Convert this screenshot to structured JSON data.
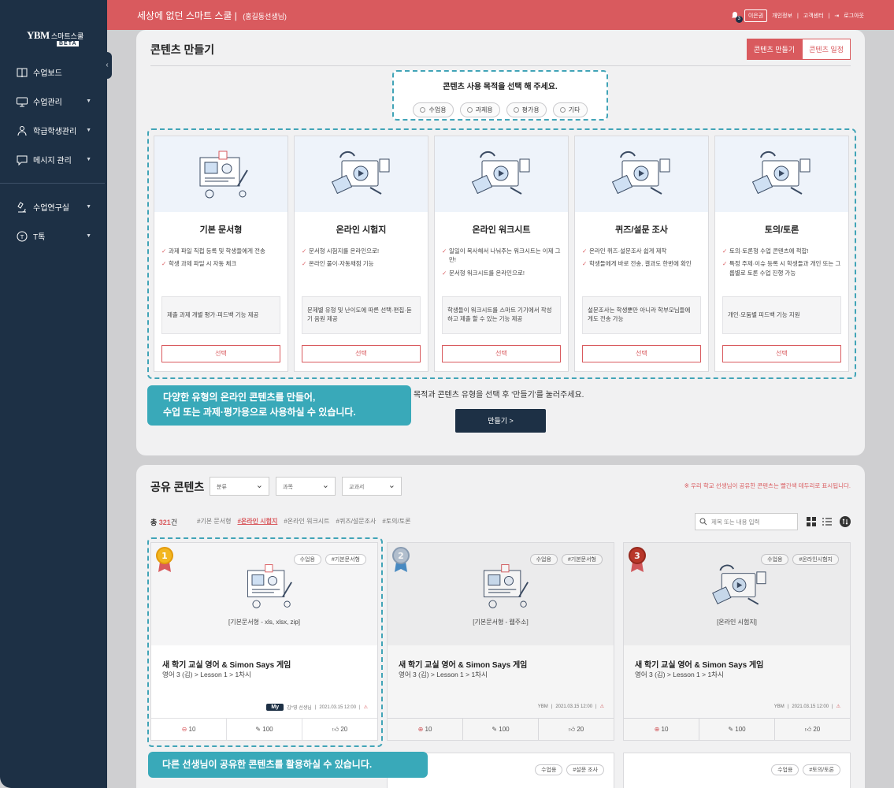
{
  "brand": {
    "logo_text": "YBM",
    "service": "스마트스쿨",
    "beta": "BETA"
  },
  "header": {
    "school_name": "세상에 없던 스마트 스쿨",
    "teacher": "(홍길동선생님)",
    "notif_count": "3",
    "user": "이은권",
    "links": [
      "개인정보",
      "고객센터",
      "로그아웃"
    ]
  },
  "sidebar": {
    "items": [
      {
        "label": "수업보드",
        "icon": "book-icon",
        "caret": false
      },
      {
        "label": "수업관리",
        "icon": "monitor-icon",
        "caret": true
      },
      {
        "label": "학급학생관리",
        "icon": "students-icon",
        "caret": true
      },
      {
        "label": "메시지 관리",
        "icon": "message-icon",
        "caret": true
      },
      {
        "label": "수업연구실",
        "icon": "microscope-icon",
        "caret": true
      },
      {
        "label": "T톡",
        "icon": "t-talk-icon",
        "caret": true
      }
    ]
  },
  "create": {
    "title": "콘텐츠 만들기",
    "tabs": [
      "콘텐츠 만들기",
      "콘텐츠 일정"
    ],
    "purpose_question": "콘텐츠 사용 목적을 선택 해 주세요.",
    "purpose_options": [
      "수업용",
      "과제용",
      "평가용",
      "기타"
    ],
    "cards": [
      {
        "name": "기본 문서형",
        "features": [
          "과제 파일 직접 등록 및 학생들에게 전송",
          "학생 과제 파일 시 자동 체크"
        ],
        "note": "제출 과제 개별 평가·피드백 기능 제공",
        "button": "선택"
      },
      {
        "name": "온라인 시험지",
        "features": [
          "문서형 시험지를 온라인으로!",
          "온라인 풀이·자동채점 기능"
        ],
        "note": "문제별 유형 및 난이도에 따른 선택·편집·듣기 음원 제공",
        "button": "선택"
      },
      {
        "name": "온라인 워크시트",
        "features": [
          "일일이 복사해서 나눠주는 워크시트는 이제 그만!",
          "문서형 워크시트를 온라인으로!"
        ],
        "note": "학생들이 워크시트를 스마트 기기에서 작성하고 제출 할 수 있는 기능 제공",
        "button": "선택"
      },
      {
        "name": "퀴즈/설문 조사",
        "features": [
          "온라인 퀴즈·설문조사 쉽게 제작",
          "학생들에게 바로 전송, 결과도 한번에 확인"
        ],
        "note": "설문조사는 학생뿐만 아니라 학부모님들에게도 전송 가능",
        "button": "선택"
      },
      {
        "name": "토의/토론",
        "features": [
          "토의·토론형 수업 콘텐츠에 적합!",
          "특정 주제·이슈 등록 시 학생들과 개인 또는 그룹별로 토론 수업 진행 가능"
        ],
        "note": "개인·모둠별 피드백 기능 지원",
        "button": "선택"
      }
    ],
    "hint": "용 목적과 콘텐츠 유형을 선택 후 '만들기'를 눌러주세요.",
    "make_button": "만들기 >",
    "tip_line1": "다양한 유형의 온라인 콘텐츠를 만들어,",
    "tip_line2": "수업 또는 과제·평가용으로 사용하실 수 있습니다."
  },
  "shared": {
    "title": "공유 콘텐츠",
    "filters": [
      "분류",
      "과목",
      "교과서"
    ],
    "notice": "※ 우리 학교 선생님이 공유한 콘텐츠는 빨간색 테두리로 표시됩니다.",
    "total_prefix": "총",
    "total_count": "321",
    "total_suffix": "건",
    "tags": [
      "#기본 문서형",
      "#온라인 시험지",
      "#온라인 워크시트",
      "#퀴즈/설문조사",
      "#토의/토론"
    ],
    "active_tag": "#온라인 시험지",
    "search_placeholder": "제목 또는 내용 입력",
    "cards": [
      {
        "rank": "1",
        "badges": [
          "수업용",
          "#기본문서형"
        ],
        "format": "[기본문서형 - xls, xlsx, zip]",
        "title": "새 학기 교실 영어 & Simon Says 게임",
        "sub": "영어 3 (김) > Lesson 1 > 1차시",
        "my": "My",
        "author": "김*영 선생님",
        "date": "2021.03.15 12:00",
        "likes": "10",
        "pins": "100",
        "thumbs": "20"
      },
      {
        "rank": "2",
        "badges": [
          "수업용",
          "#기본문서형"
        ],
        "format": "[기본문서형 - 웹주소]",
        "title": "새 학기 교실 영어 & Simon Says 게임",
        "sub": "영어 3 (김) > Lesson 1 > 1차시",
        "author": "YBM",
        "date": "2021.03.15 12:00",
        "likes": "10",
        "pins": "100",
        "thumbs": "20"
      },
      {
        "rank": "3",
        "badges": [
          "수업용",
          "#온라인시험지"
        ],
        "format": "[온라인 시험지]",
        "title": "새 학기 교실 영어 & Simon Says 게임",
        "sub": "영어 3 (김) > Lesson 1 > 1차시",
        "author": "YBM",
        "date": "2021.03.15 12:00",
        "likes": "10",
        "pins": "100",
        "thumbs": "20"
      }
    ],
    "peek_cards": [
      {
        "badges": [
          "수업용",
          "#설문 조사"
        ]
      },
      {
        "badges": [
          "수업용",
          "#토의/토론"
        ]
      }
    ],
    "tip": "다른 선생님이 공유한 콘텐츠를 활용하실 수 있습니다."
  },
  "colors": {
    "brand_red": "#d95a5e",
    "navy": "#1d3045",
    "teal": "#39a9b9"
  }
}
